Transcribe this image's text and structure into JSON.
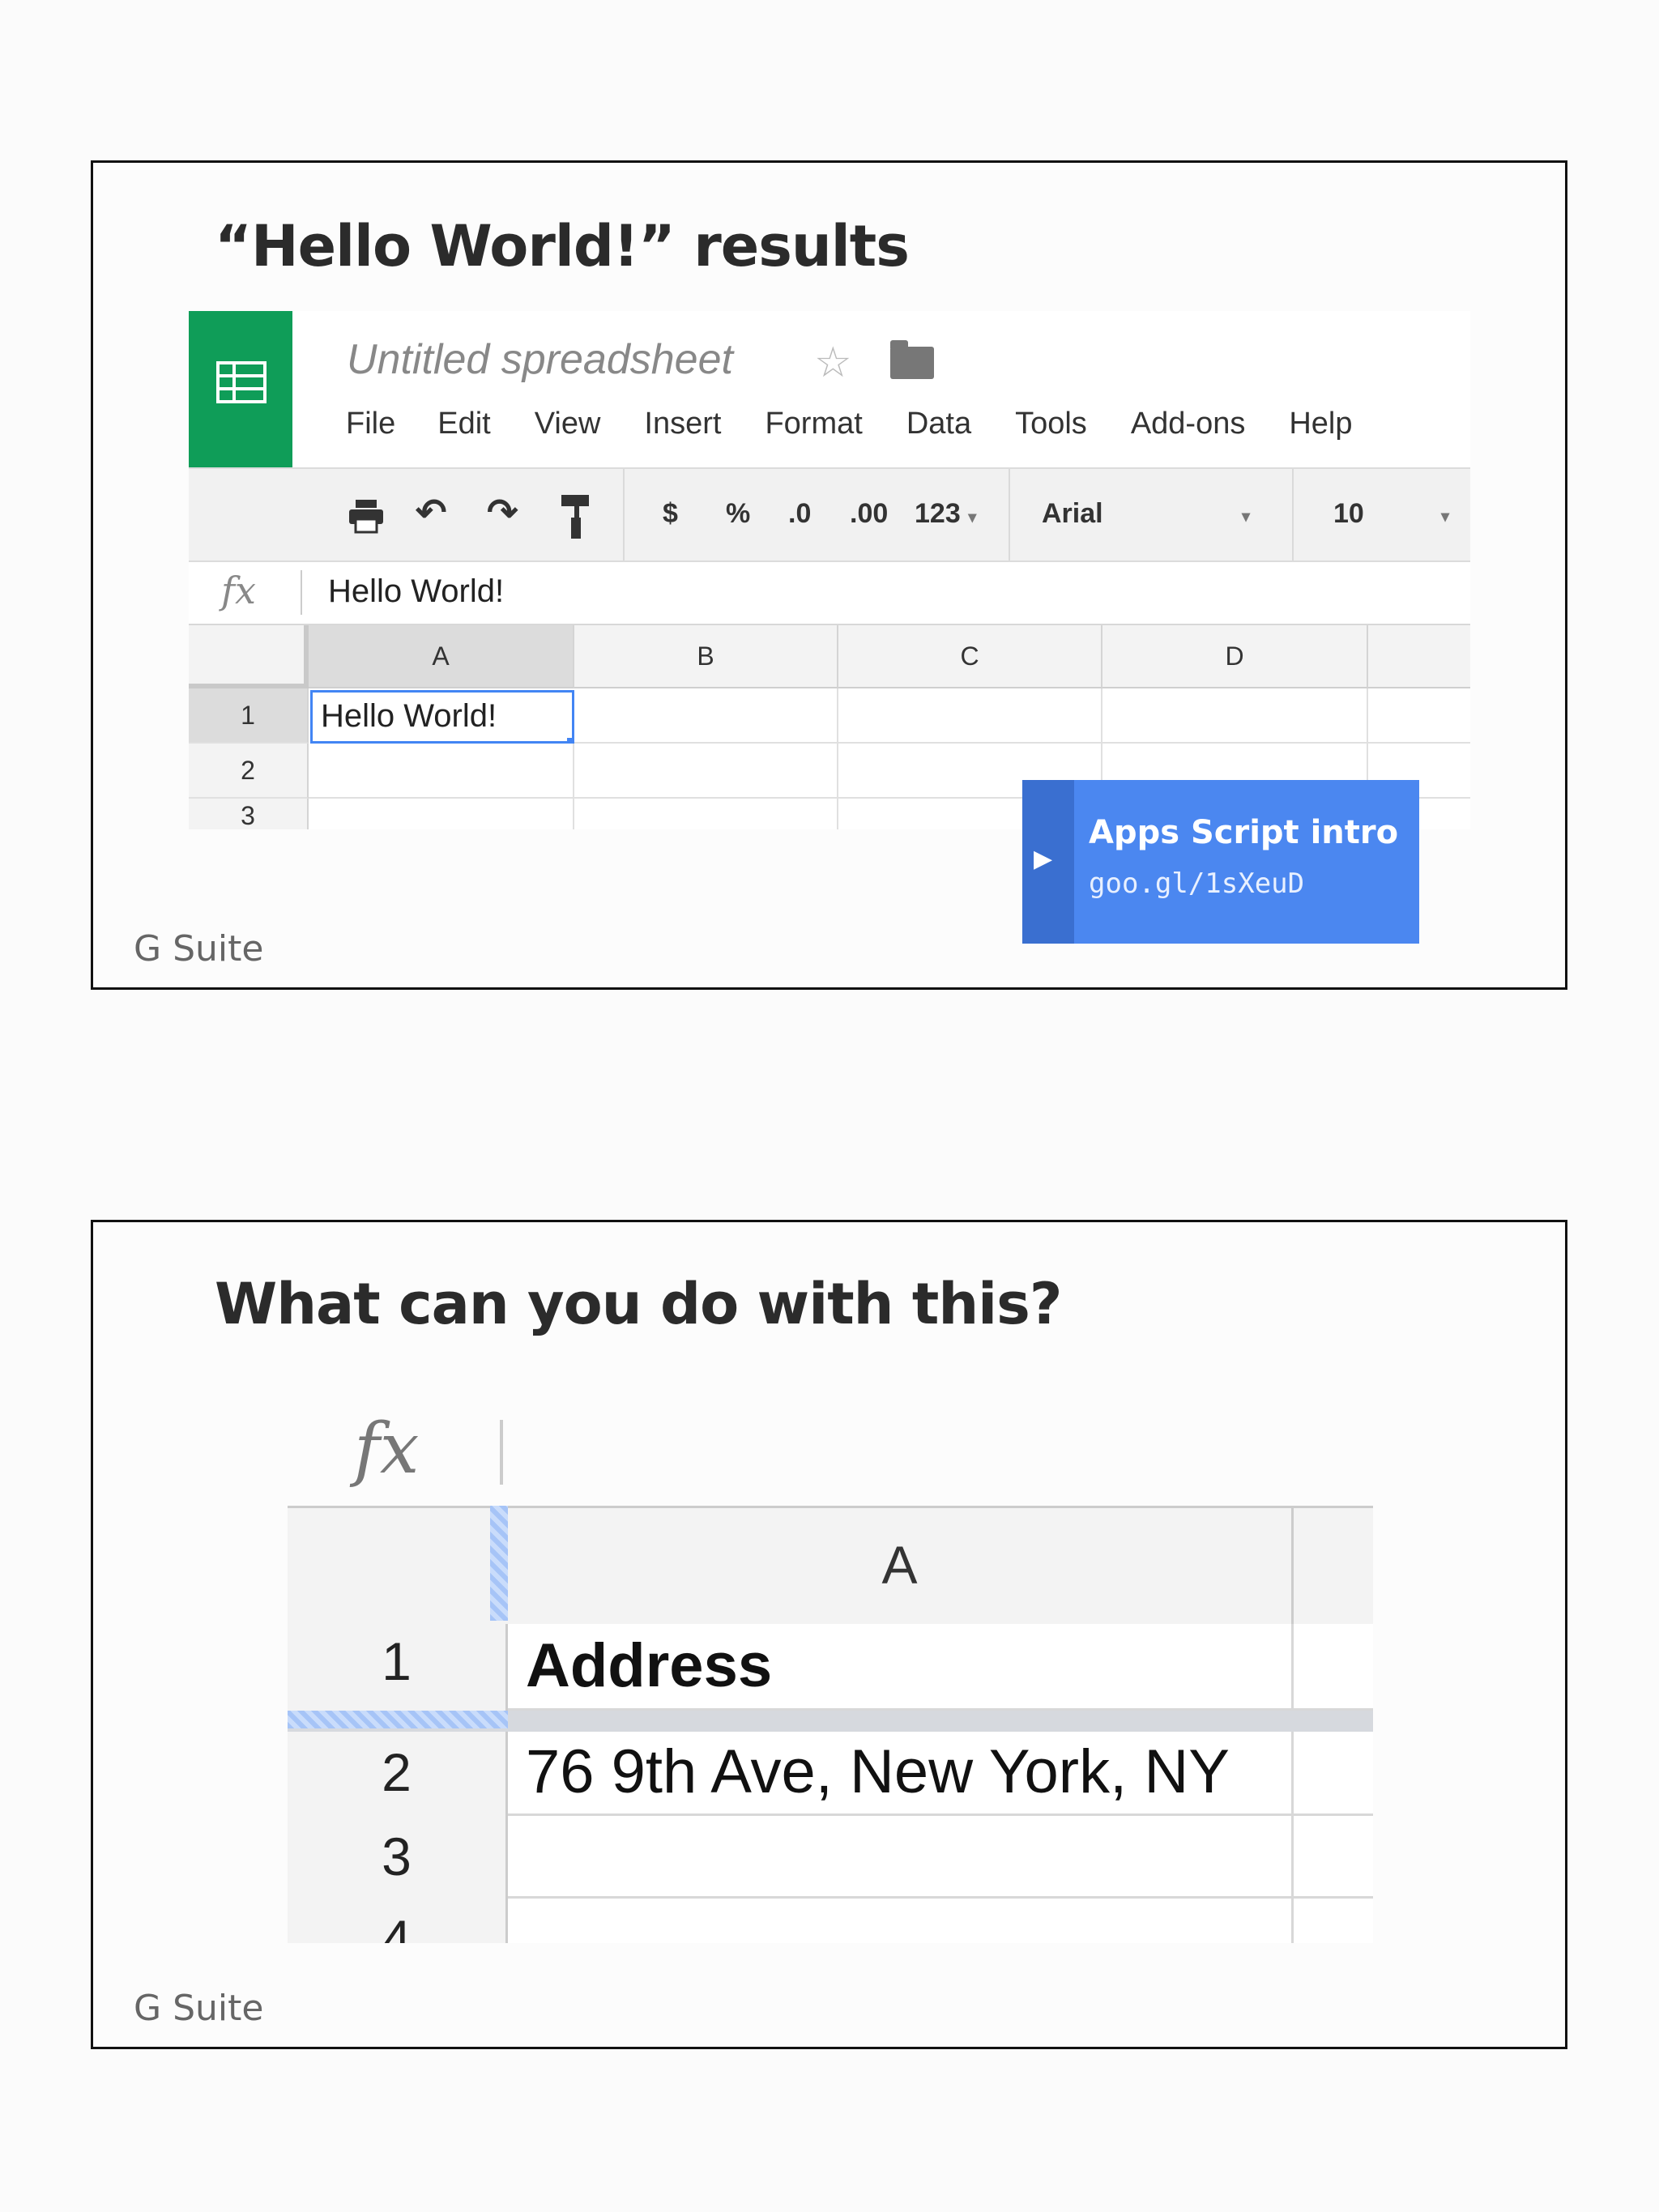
{
  "slide1": {
    "title": "“Hello World!” results",
    "footer_brand": "G Suite",
    "spreadsheet": {
      "doc_title": "Untitled spreadsheet",
      "menu": [
        "File",
        "Edit",
        "View",
        "Insert",
        "Format",
        "Data",
        "Tools",
        "Add-ons",
        "Help"
      ],
      "toolbar": {
        "currency": "$",
        "percent": "%",
        "decrease_decimals": ".0",
        "increase_decimals": ".00",
        "more_formats": "123",
        "font": "Arial",
        "font_size": "10"
      },
      "formula_bar": {
        "fx_label": "fx",
        "value": "Hello World!"
      },
      "columns": [
        "A",
        "B",
        "C",
        "D"
      ],
      "rows": [
        "1",
        "2",
        "3"
      ],
      "cells": {
        "A1": "Hello World!"
      }
    },
    "link_card": {
      "title": "Apps Script intro",
      "url": "goo.gl/1sXeuD"
    }
  },
  "slide2": {
    "title": "What can you do with this?",
    "footer_brand": "G Suite",
    "spreadsheet": {
      "fx_label": "fx",
      "column": "A",
      "rows": [
        "1",
        "2",
        "3",
        "4"
      ],
      "cells": {
        "A1": "Address",
        "A2": "76 9th Ave, New York, NY",
        "A3": "",
        "A4": ""
      }
    }
  },
  "colors": {
    "sheets_green": "#0f9d58",
    "link_card_blue": "#4b87f0",
    "selection_blue": "#4285f4"
  }
}
